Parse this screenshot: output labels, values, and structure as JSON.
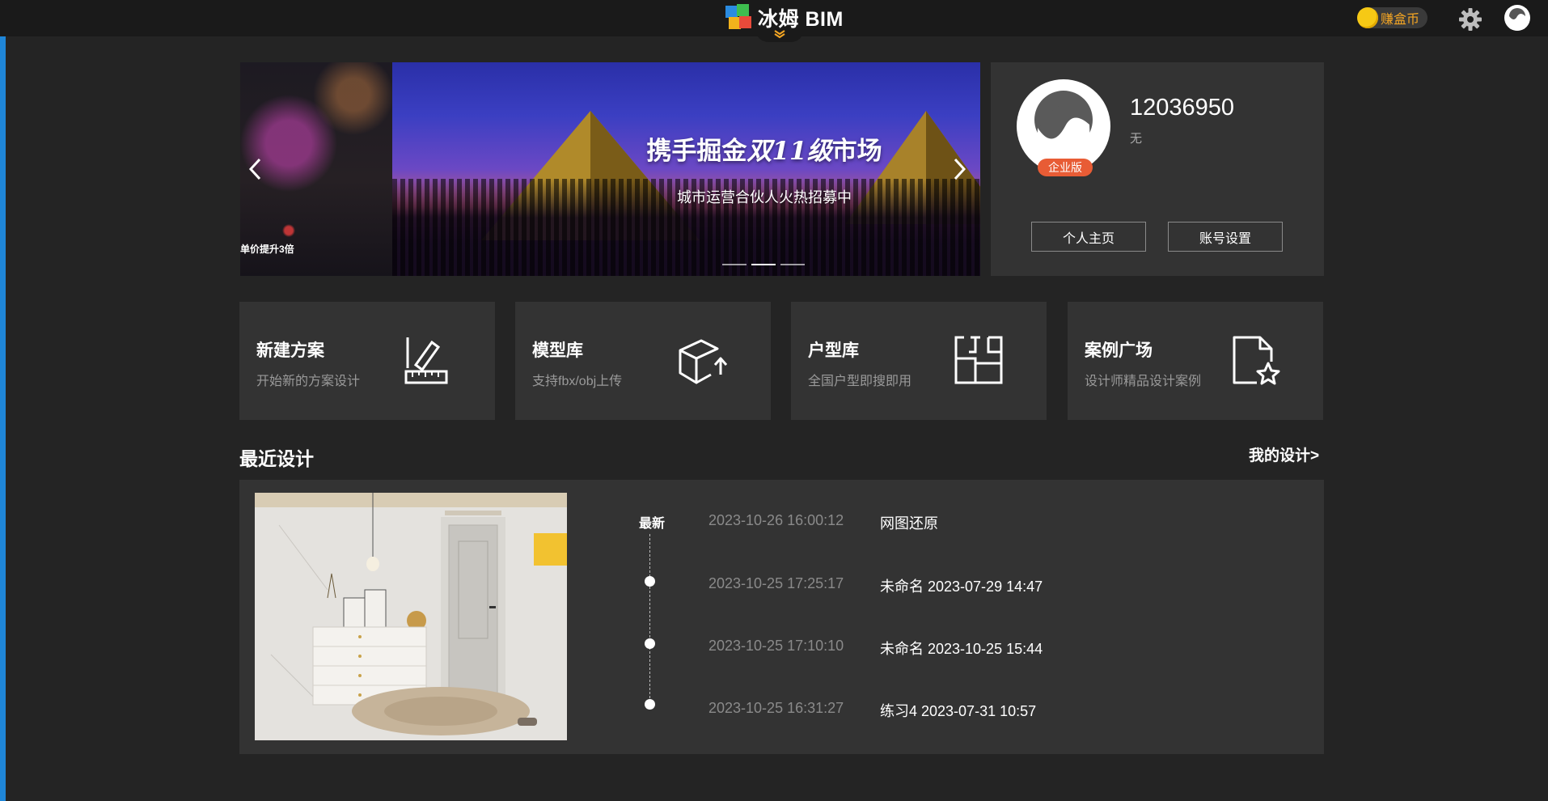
{
  "app": {
    "logo_text": "冰姆 BIM",
    "coin_label": "赚盒币"
  },
  "banner": {
    "title_prefix": "携手掘金",
    "title_script": "双11级",
    "title_suffix": "市场",
    "subtitle": "城市运营合伙人火热招募中",
    "side_caption": "单价提升3倍",
    "slides": 3,
    "active_slide": 1
  },
  "profile": {
    "user_id": "12036950",
    "description": "无",
    "badge": "企业版",
    "home_button": "个人主页",
    "settings_button": "账号设置"
  },
  "quick_cards": [
    {
      "title": "新建方案",
      "subtitle": "开始新的方案设计",
      "icon": "pencil-ruler-icon"
    },
    {
      "title": "模型库",
      "subtitle": "支持fbx/obj上传",
      "icon": "box-upload-icon"
    },
    {
      "title": "户型库",
      "subtitle": "全国户型即搜即用",
      "icon": "floorplan-icon"
    },
    {
      "title": "案例广场",
      "subtitle": "设计师精品设计案例",
      "icon": "file-star-icon"
    }
  ],
  "recent": {
    "title": "最近设计",
    "more_link": "我的设计>",
    "latest_label": "最新",
    "items": [
      {
        "time": "2023-10-26 16:00:12",
        "name": "网图还原"
      },
      {
        "time": "2023-10-25 17:25:17",
        "name": "未命名 2023-07-29 14:47"
      },
      {
        "time": "2023-10-25 17:10:10",
        "name": "未命名 2023-10-25 15:44"
      },
      {
        "time": "2023-10-25 16:31:27",
        "name": "练习4 2023-07-31 10:57"
      }
    ]
  }
}
